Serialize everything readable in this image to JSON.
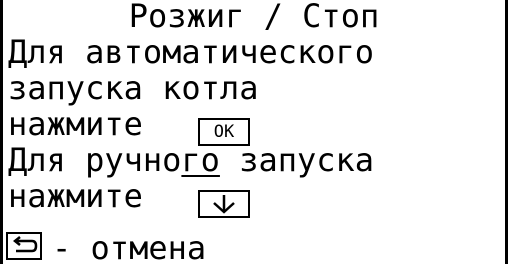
{
  "title": "Розжиг / Стоп",
  "auto_line1": "Для автоматического",
  "auto_line2": "запуска котла",
  "auto_press": "нажмите",
  "ok_key_label": "OK",
  "manual_line1_a": "Для ручно",
  "manual_line1_b": "го",
  "manual_line1_c": " запуска",
  "manual_press": "нажмите",
  "cancel_text": "- отмена",
  "icons": {
    "ok_key": "ok-key-icon",
    "down_key": "down-arrow-icon",
    "back_key": "back-arrow-icon"
  }
}
